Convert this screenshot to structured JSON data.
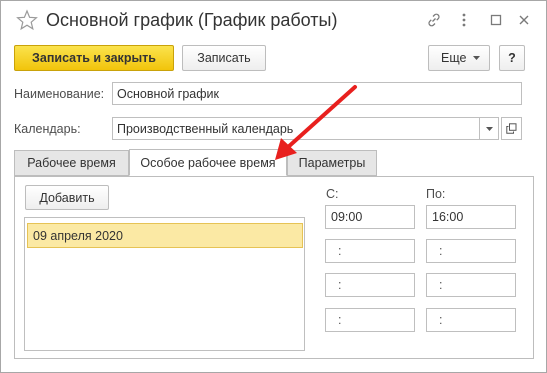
{
  "window": {
    "title": "Основной график (График работы)"
  },
  "toolbar": {
    "save_close_label": "Записать и закрыть",
    "save_label": "Записать",
    "more_label": "Еще",
    "help_label": "?"
  },
  "form": {
    "name_label": "Наименование:",
    "name_value": "Основной график",
    "calendar_label": "Календарь:",
    "calendar_value": "Производственный календарь"
  },
  "tabs": [
    {
      "label": "Рабочее время"
    },
    {
      "label": "Особое рабочее время"
    },
    {
      "label": "Параметры"
    }
  ],
  "special_time": {
    "add_label": "Добавить",
    "dates": [
      "09 апреля 2020"
    ],
    "from_label": "С:",
    "to_label": "По:",
    "from_times": [
      "09:00",
      ":",
      ":",
      ":"
    ],
    "to_times": [
      "16:00",
      ":",
      ":",
      ":"
    ]
  },
  "colors": {
    "primary_button": "#f1c40b",
    "selected_row": "#fbe9a4",
    "annotation_arrow": "#e8201e"
  }
}
